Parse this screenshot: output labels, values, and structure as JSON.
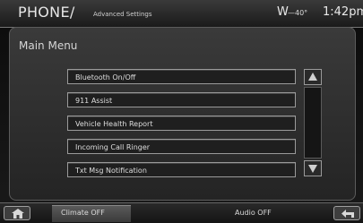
{
  "header": {
    "title": "PHONE/",
    "subtitle": "Advanced Settings",
    "compass_icon": "compass-w-icon",
    "compass": "W",
    "temperature": "—40°",
    "clock": "1:42pm"
  },
  "main": {
    "heading": "Main Menu",
    "items": [
      {
        "label": "Bluetooth On/Off"
      },
      {
        "label": "911 Assist"
      },
      {
        "label": "Vehicle Health Report"
      },
      {
        "label": "Incoming Call Ringer"
      },
      {
        "label": "Txt Msg Notification"
      }
    ],
    "scroll_up_icon": "arrow-up-icon",
    "scroll_down_icon": "arrow-down-icon"
  },
  "footer": {
    "home_icon": "home-icon",
    "climate_label": "Climate OFF",
    "audio_label": "Audio OFF",
    "back_icon": "back-icon"
  }
}
